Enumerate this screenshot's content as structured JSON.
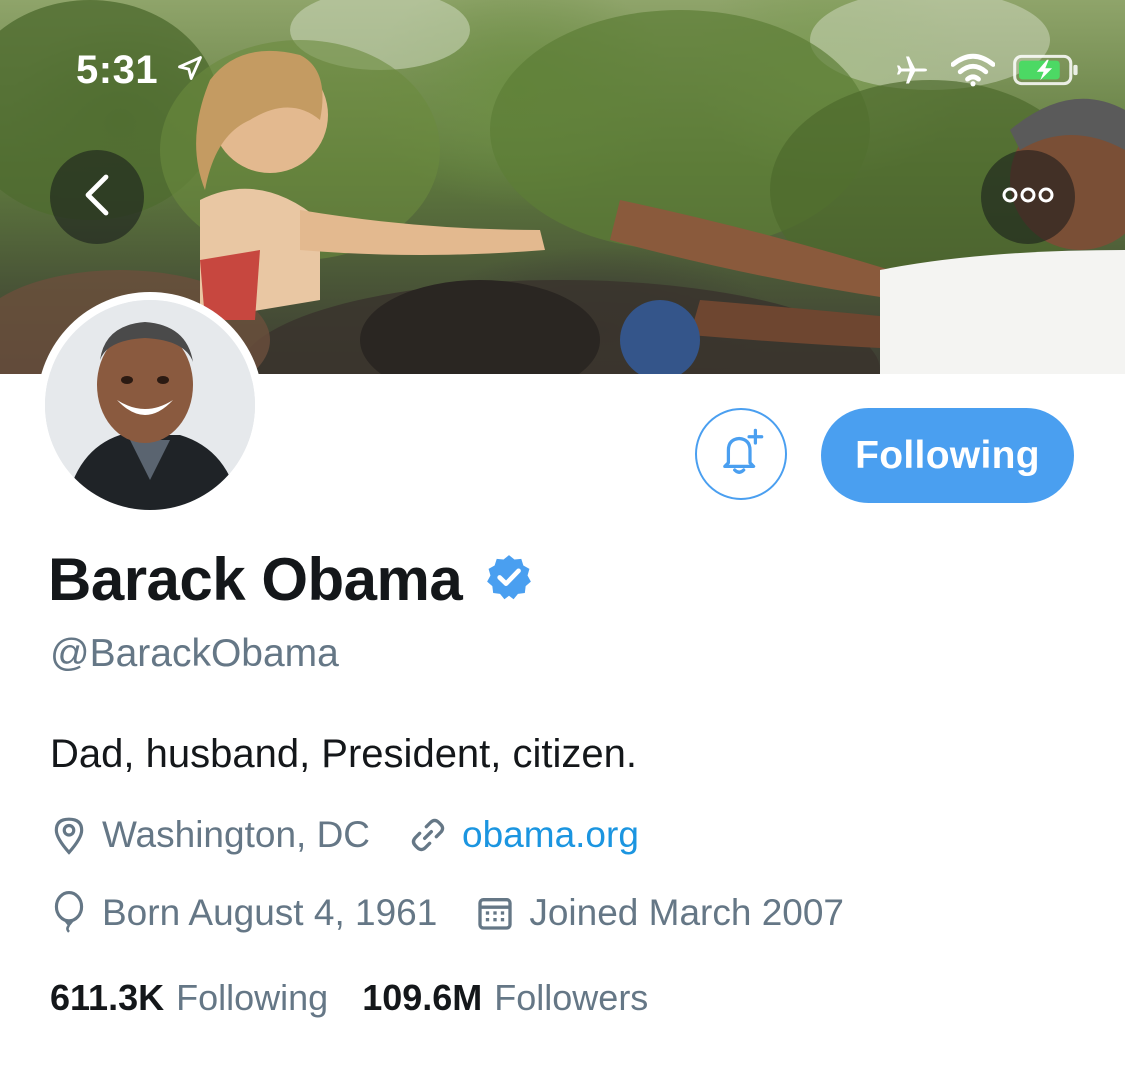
{
  "status_bar": {
    "time": "5:31",
    "icons": [
      "location-arrow-icon",
      "airplane-icon",
      "wifi-icon",
      "battery-charging-icon"
    ]
  },
  "header": {
    "nav_back_icon": "chevron-left-icon",
    "more_icon": "more-dots-icon",
    "banner_description_present": true
  },
  "profile": {
    "name": "Barack Obama",
    "verified": true,
    "handle": "@BarackObama",
    "bio": "Dad, husband, President, citizen.",
    "location": "Washington, DC",
    "website": "obama.org",
    "birthday": "Born August 4, 1961",
    "joined": "Joined March 2007"
  },
  "actions": {
    "notify_icon": "bell-plus-icon",
    "following_label": "Following"
  },
  "stats": {
    "following_count": "611.3K",
    "following_label": "Following",
    "followers_count": "109.6M",
    "followers_label": "Followers"
  },
  "colors": {
    "accent": "#4a9ff0",
    "link": "#1b95e0",
    "secondary_text": "#657786",
    "primary_text": "#14171a"
  }
}
